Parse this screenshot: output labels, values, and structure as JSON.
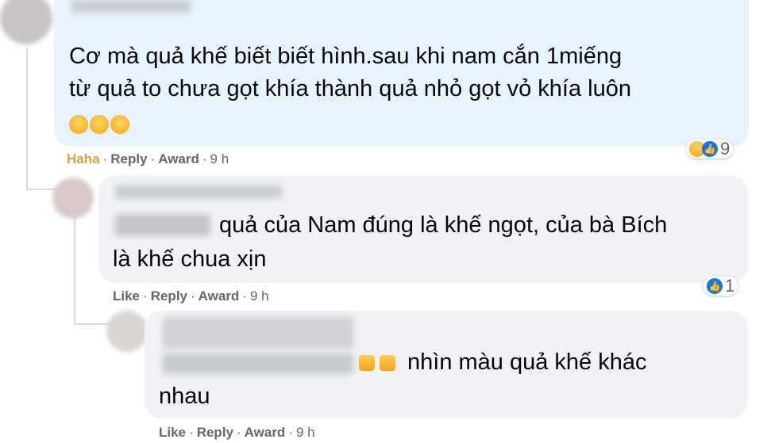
{
  "comments": [
    {
      "text_lines": [
        "Cơ mà quả khế biết biết hình.sau khi nam cắn 1miếng",
        "từ quả to chưa gọt khía thành quả nhỏ gọt vỏ khía luôn"
      ],
      "emoji_tail": "😂😂😂",
      "actions": {
        "reaction": "Haha",
        "reply": "Reply",
        "award": "Award",
        "time": "9 h"
      },
      "reaction_count": "9"
    },
    {
      "text_lines": [
        "quả của Nam đúng là khế ngọt, của bà Bích",
        "là khế chua xịn"
      ],
      "actions": {
        "reaction": "Like",
        "reply": "Reply",
        "award": "Award",
        "time": "9 h"
      },
      "reaction_count": "1"
    },
    {
      "text_lines": [
        "nhìn màu quả khế khác",
        "nhau"
      ],
      "actions": {
        "reaction": "Like",
        "reply": "Reply",
        "award": "Award",
        "time": "9 h"
      }
    }
  ],
  "separator": "·",
  "colors": {
    "bubble_top": "#e7f3ff",
    "bubble_reply": "#f0f2f5",
    "haha": "#d4a33a",
    "meta": "#65676b"
  }
}
